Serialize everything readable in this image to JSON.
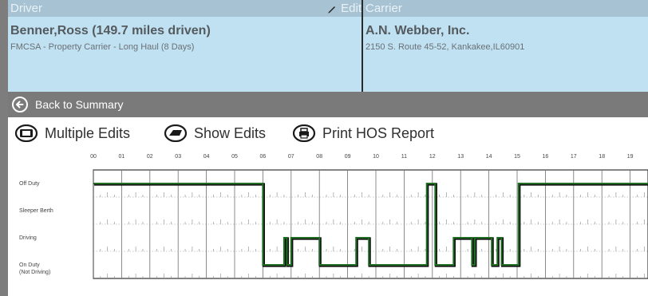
{
  "driver_panel": {
    "header": "Driver",
    "edit_label": "Edit",
    "name": "Benner,Ross (149.7 miles driven)",
    "ruleset": "FMCSA - Property Carrier - Long Haul (8 Days)"
  },
  "carrier_panel": {
    "header": "Carrier",
    "name": "A.N. Webber, Inc.",
    "address": "2150 S. Route 45-52, Kankakee,IL60901"
  },
  "navigation": {
    "back_label": "Back to Summary"
  },
  "toolbar": {
    "multiple_edits": "Multiple Edits",
    "show_edits": "Show Edits",
    "print_report": "Print HOS Report"
  },
  "graph": {
    "hour_labels": [
      "00",
      "01",
      "02",
      "03",
      "04",
      "05",
      "06",
      "07",
      "08",
      "09",
      "10",
      "11",
      "12",
      "13",
      "14",
      "15",
      "16",
      "17",
      "18",
      "19"
    ],
    "status_labels": [
      "Off Duty",
      "Sleeper Berth",
      "Driving",
      "On Duty"
    ],
    "on_duty_note": "(Not Driving)",
    "status_changes": [
      {
        "hour": 0,
        "status": 0
      },
      {
        "hour": 6.0,
        "status": 3
      },
      {
        "hour": 6.75,
        "status": 2
      },
      {
        "hour": 6.85,
        "status": 3
      },
      {
        "hour": 7.0,
        "status": 2
      },
      {
        "hour": 8.0,
        "status": 3
      },
      {
        "hour": 9.3,
        "status": 2
      },
      {
        "hour": 9.75,
        "status": 3
      },
      {
        "hour": 11.8,
        "status": 0
      },
      {
        "hour": 12.1,
        "status": 3
      },
      {
        "hour": 12.75,
        "status": 2
      },
      {
        "hour": 13.4,
        "status": 3
      },
      {
        "hour": 13.5,
        "status": 2
      },
      {
        "hour": 14.1,
        "status": 3
      },
      {
        "hour": 14.3,
        "status": 2
      },
      {
        "hour": 14.45,
        "status": 3
      },
      {
        "hour": 15.05,
        "status": 0
      }
    ],
    "line_color": "#1f6e22",
    "grid_color": "#6f6f6f"
  }
}
